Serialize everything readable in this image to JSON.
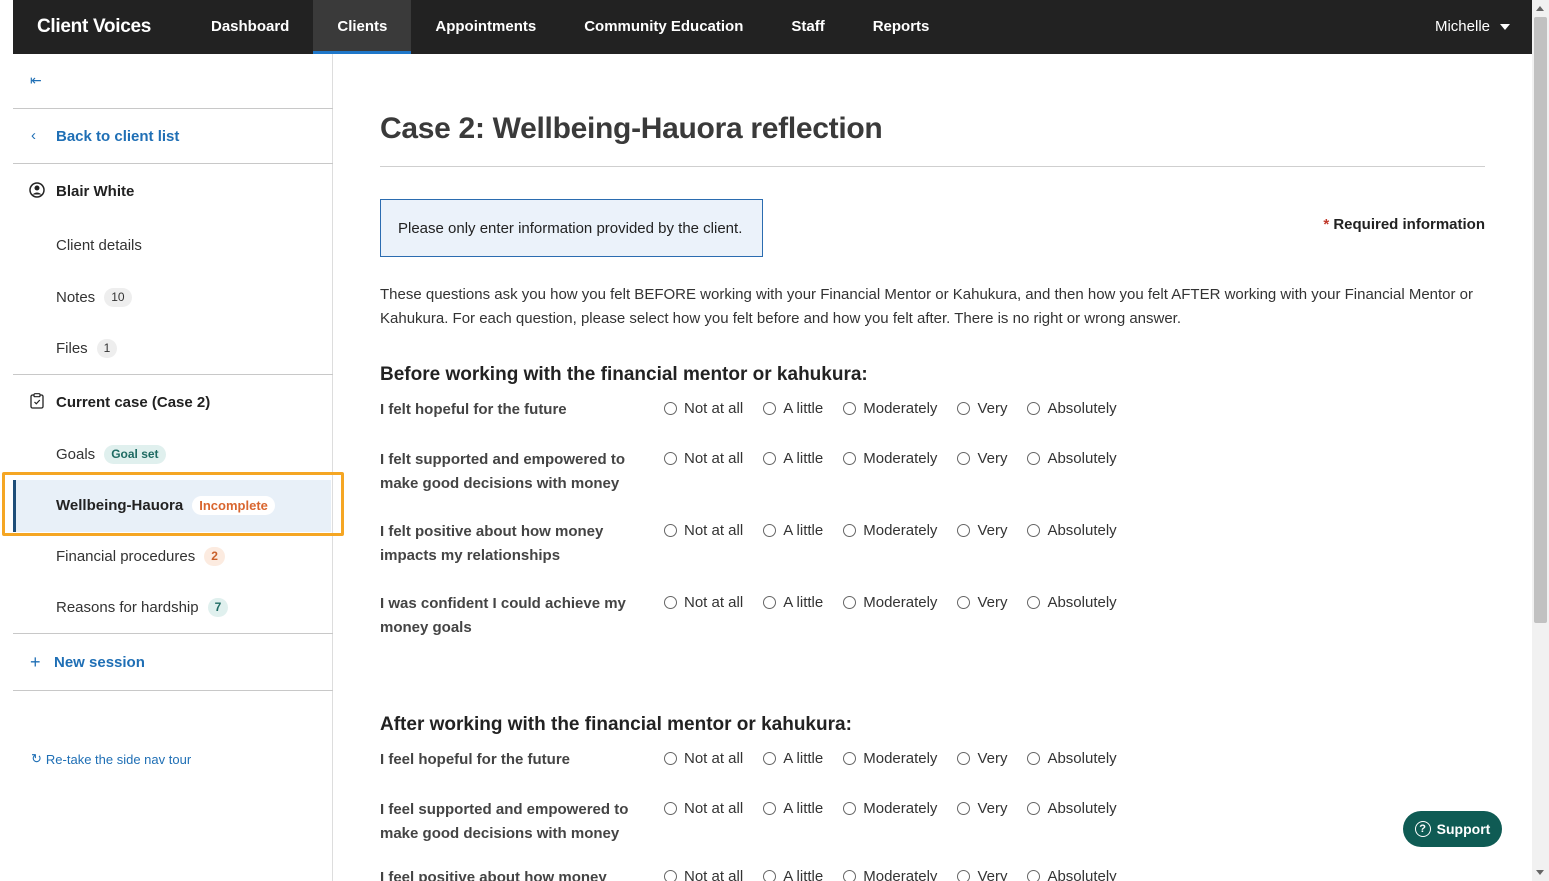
{
  "app": {
    "title": "Client Voices"
  },
  "nav": {
    "items": [
      "Dashboard",
      "Clients",
      "Appointments",
      "Community Education",
      "Staff",
      "Reports"
    ],
    "active": "Clients",
    "user": "Michelle"
  },
  "sidebar": {
    "collapse_glyph": "⇤",
    "back_label": "Back to client list",
    "client_name": "Blair White",
    "client_details": "Client details",
    "notes_label": "Notes",
    "notes_count": "10",
    "files_label": "Files",
    "files_count": "1",
    "current_case": "Current case (Case 2)",
    "goals_label": "Goals",
    "goals_badge": "Goal set",
    "wellbeing_label": "Wellbeing-Hauora",
    "wellbeing_badge": "Incomplete",
    "financial_label": "Financial procedures",
    "financial_count": "2",
    "hardship_label": "Reasons for hardship",
    "hardship_count": "7",
    "new_session": "New session",
    "retake": "Re-take the side nav tour"
  },
  "main": {
    "title": "Case 2: Wellbeing-Hauora reflection",
    "info": "Please only enter information provided by the client.",
    "required_star": "*",
    "required_label": "Required information",
    "intro": "These questions ask you how you felt BEFORE working with your Financial Mentor or Kahukura, and then how you felt AFTER working with your Financial Mentor or Kahukura. For each question, please select how you felt before and how you felt after. There is no right or wrong answer.",
    "options": [
      "Not at all",
      "A little",
      "Moderately",
      "Very",
      "Absolutely"
    ],
    "before": {
      "heading": "Before working with the financial mentor or kahukura:",
      "questions": [
        "I felt hopeful for the future",
        "I felt supported and empowered to make good decisions with money",
        "I felt positive about how money impacts my relationships",
        "I was confident I could achieve my money goals"
      ]
    },
    "after": {
      "heading": "After working with the financial mentor or kahukura:",
      "questions": [
        "I feel hopeful for the future",
        "I feel supported and empowered to make good decisions with money",
        "I feel positive about how money"
      ]
    }
  },
  "support": {
    "label": "Support"
  }
}
